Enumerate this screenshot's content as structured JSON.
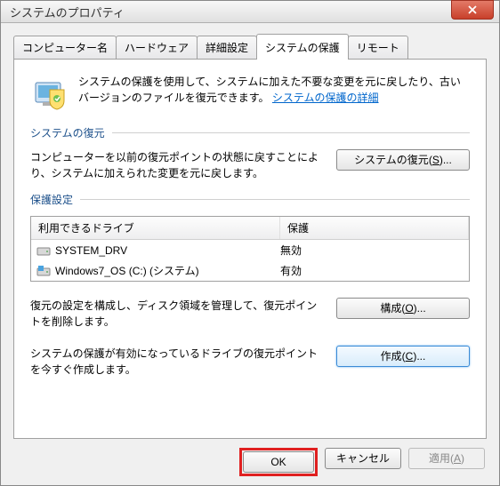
{
  "window": {
    "title": "システムのプロパティ"
  },
  "tabs": [
    {
      "label": "コンピューター名"
    },
    {
      "label": "ハードウェア"
    },
    {
      "label": "詳細設定"
    },
    {
      "label": "システムの保護"
    },
    {
      "label": "リモート"
    }
  ],
  "intro": {
    "text": "システムの保護を使用して、システムに加えた不要な変更を元に戻したり、古いバージョンのファイルを復元できます。",
    "link": "システムの保護の詳細"
  },
  "restore_group": {
    "title": "システムの復元",
    "desc": "コンピューターを以前の復元ポイントの状態に戻すことにより、システムに加えられた変更を元に戻します。",
    "button": "システムの復元(S)...",
    "button_key": "S"
  },
  "settings_group": {
    "title": "保護設定",
    "header_drive": "利用できるドライブ",
    "header_protection": "保護",
    "drives": [
      {
        "name": "SYSTEM_DRV",
        "protection": "無効",
        "icon": "disk"
      },
      {
        "name": "Windows7_OS (C:) (システム)",
        "protection": "有効",
        "icon": "disk-win"
      }
    ],
    "configure_desc": "復元の設定を構成し、ディスク領域を管理して、復元ポイントを削除します。",
    "configure_button": "構成(O)...",
    "configure_key": "O",
    "create_desc": "システムの保護が有効になっているドライブの復元ポイントを今すぐ作成します。",
    "create_button": "作成(C)...",
    "create_key": "C"
  },
  "footer": {
    "ok": "OK",
    "cancel": "キャンセル",
    "apply": "適用(A)",
    "apply_key": "A"
  }
}
